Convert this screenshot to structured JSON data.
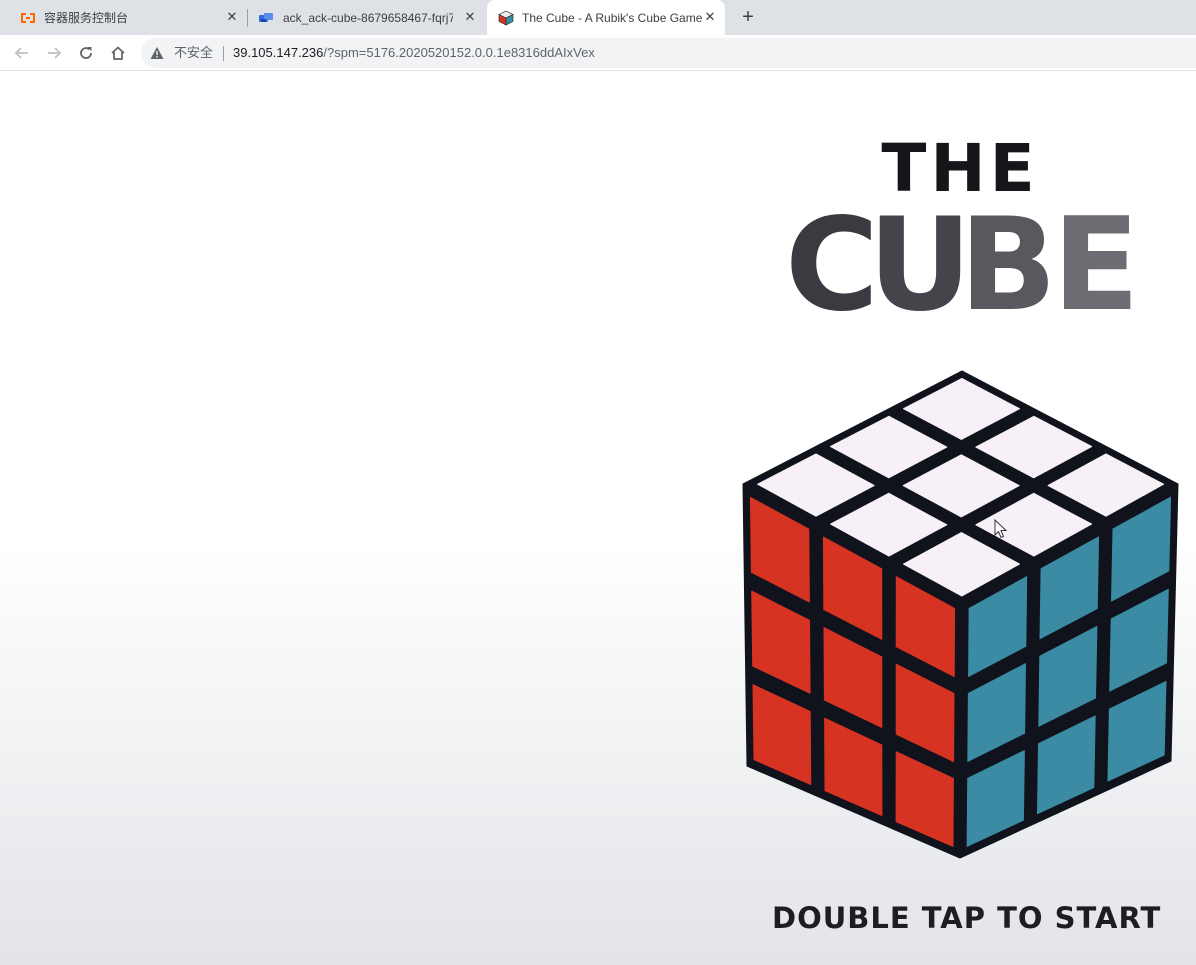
{
  "browser": {
    "tabs": [
      {
        "title": "容器服务控制台",
        "icon": "aliyun-logo-icon",
        "active": false
      },
      {
        "title": "ack_ack-cube-8679658467-fqrj7",
        "icon": "kubernetes-pod-icon",
        "active": false
      },
      {
        "title": "The Cube - A Rubik's Cube Game",
        "icon": "rubiks-cube-icon",
        "active": true
      }
    ],
    "new_tab_label": "+",
    "address": {
      "security_label": "不安全",
      "host": "39.105.147.236",
      "path": "/?spm=5176.2020520152.0.0.1e8316ddAIxVex"
    }
  },
  "game": {
    "logo_line1": "THE",
    "logo_line2_letters": [
      "C",
      "U",
      "B",
      "E"
    ],
    "logo_letter_colors": [
      "#3a3b40",
      "#44454a",
      "#58595e",
      "#6c6d72"
    ],
    "logo_line1_color": "#16161a",
    "start_prompt": "DOUBLE TAP TO START",
    "cube_face_colors": {
      "top": "#f7f1f7",
      "left": "#d63322",
      "right": "#3a8ba3",
      "body": "#10131c"
    }
  }
}
